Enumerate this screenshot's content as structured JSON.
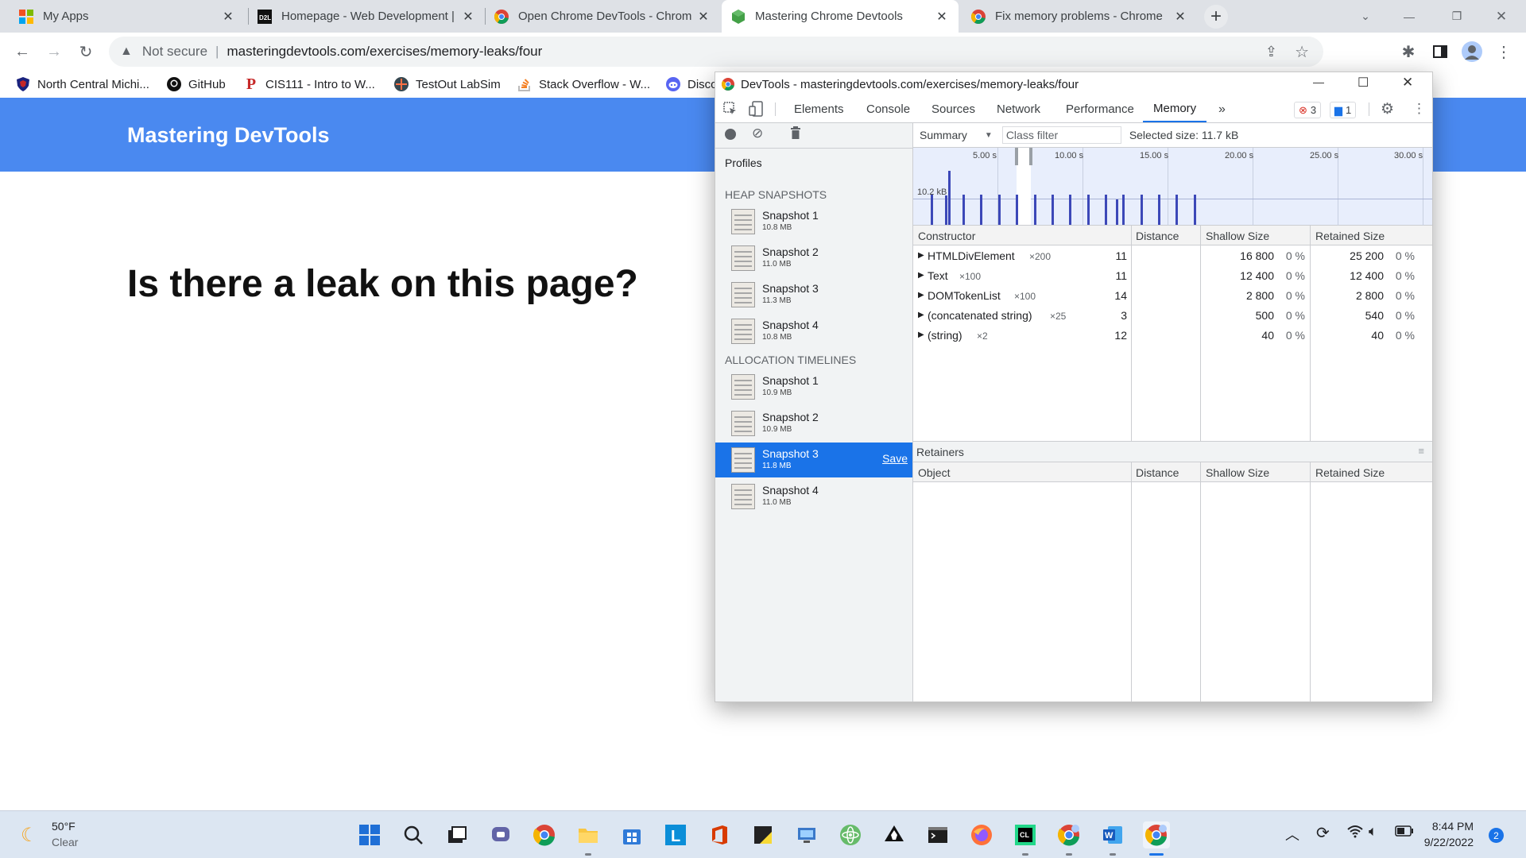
{
  "browser": {
    "tabs": [
      {
        "title": "My Apps",
        "icon": "microsoft-apps-icon"
      },
      {
        "title": "Homepage - Web Development |",
        "icon": "d2l-icon"
      },
      {
        "title": "Open Chrome DevTools - Chrom",
        "icon": "chrome-icon"
      },
      {
        "title": "Mastering Chrome Devtools",
        "icon": "green-hexagon-icon",
        "active": true
      },
      {
        "title": "Fix memory problems - Chrome",
        "icon": "chrome-icon"
      }
    ],
    "security_label": "Not secure",
    "url": "masteringdevtools.com/exercises/memory-leaks/four",
    "bookmarks": [
      {
        "label": "North Central Michi...",
        "icon": "shield-icon"
      },
      {
        "label": "GitHub",
        "icon": "github-icon"
      },
      {
        "label": "CIS111 - Intro to W...",
        "icon": "p-logo-icon"
      },
      {
        "label": "TestOut LabSim",
        "icon": "testout-icon"
      },
      {
        "label": "Stack Overflow - W...",
        "icon": "stackoverflow-icon"
      },
      {
        "label": "Disco",
        "icon": "discord-icon"
      }
    ]
  },
  "page": {
    "brand": "Mastering DevTools",
    "heading": "Is there a leak on this page?"
  },
  "devtools": {
    "window_title": "DevTools - masteringdevtools.com/exercises/memory-leaks/four",
    "tabs": [
      "Elements",
      "Console",
      "Sources",
      "Network",
      "Performance",
      "Memory"
    ],
    "active_tab": "Memory",
    "error_count": "3",
    "message_count": "1",
    "sidebar": {
      "profiles_label": "Profiles",
      "heap_header": "HEAP SNAPSHOTS",
      "heap_snapshots": [
        {
          "name": "Snapshot 1",
          "size": "10.8 MB"
        },
        {
          "name": "Snapshot 2",
          "size": "11.0 MB"
        },
        {
          "name": "Snapshot 3",
          "size": "11.3 MB"
        },
        {
          "name": "Snapshot 4",
          "size": "10.8 MB"
        }
      ],
      "alloc_header": "ALLOCATION TIMELINES",
      "alloc_snapshots": [
        {
          "name": "Snapshot 1",
          "size": "10.9 MB"
        },
        {
          "name": "Snapshot 2",
          "size": "10.9 MB"
        },
        {
          "name": "Snapshot 3",
          "size": "11.8 MB",
          "selected": true
        },
        {
          "name": "Snapshot 4",
          "size": "11.0 MB"
        }
      ],
      "save_label": "Save"
    },
    "toolbar": {
      "view": "Summary",
      "class_filter_placeholder": "Class filter",
      "selected_size": "Selected size: 11.7 kB"
    },
    "timeline": {
      "ticks": [
        "5.00 s",
        "10.00 s",
        "15.00 s",
        "20.00 s",
        "25.00 s",
        "30.00 s"
      ],
      "scale_label": "10.2 kB"
    },
    "constructor_table": {
      "headers": [
        "Constructor",
        "Distance",
        "Shallow Size",
        "Retained Size"
      ],
      "rows": [
        {
          "name": "HTMLDivElement",
          "count": "×200",
          "distance": "11",
          "shallow": "16 800",
          "shallow_pct": "0 %",
          "retained": "25 200",
          "retained_pct": "0 %"
        },
        {
          "name": "Text",
          "count": "×100",
          "distance": "11",
          "shallow": "12 400",
          "shallow_pct": "0 %",
          "retained": "12 400",
          "retained_pct": "0 %"
        },
        {
          "name": "DOMTokenList",
          "count": "×100",
          "distance": "14",
          "shallow": "2 800",
          "shallow_pct": "0 %",
          "retained": "2 800",
          "retained_pct": "0 %"
        },
        {
          "name": "(concatenated string)",
          "count": "×25",
          "distance": "3",
          "shallow": "500",
          "shallow_pct": "0 %",
          "retained": "540",
          "retained_pct": "0 %"
        },
        {
          "name": "(string)",
          "count": "×2",
          "distance": "12",
          "shallow": "40",
          "shallow_pct": "0 %",
          "retained": "40",
          "retained_pct": "0 %"
        }
      ]
    },
    "retainers": {
      "title": "Retainers",
      "headers": [
        "Object",
        "Distance",
        "Shallow Size",
        "Retained Size"
      ]
    }
  },
  "taskbar": {
    "weather_temp": "50°F",
    "weather_desc": "Clear",
    "time": "8:44 PM",
    "date": "9/22/2022",
    "notification_count": "2"
  }
}
